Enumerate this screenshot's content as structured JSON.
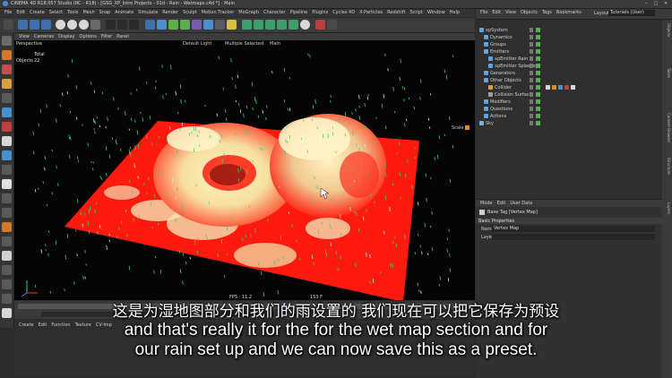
{
  "window": {
    "title": "CINEMA 4D R18.057 Studio (RC - R18) - [GSG_XP_Intro Projects - 01d - Rain - Wetmaps.c4d *] - Main"
  },
  "menubar": {
    "items": [
      "File",
      "Edit",
      "Create",
      "Select",
      "Tools",
      "Mesh",
      "Snap",
      "Animate",
      "Simulate",
      "Render",
      "Sculpt",
      "Motion Tracker",
      "MoGraph",
      "Character",
      "Pipeline",
      "Plugins",
      "Cycles 4D",
      "X-Particles",
      "Redshift",
      "Script",
      "Window",
      "Help"
    ]
  },
  "layout": {
    "label": "Layout:",
    "value": "Tutorials (User)"
  },
  "viewport": {
    "menu": [
      "View",
      "Cameras",
      "Display",
      "Options",
      "Filter",
      "Panel"
    ],
    "name": "Perspective",
    "overlay_items": [
      "Default Light",
      "Multiple Selected",
      "Main"
    ],
    "stats_label": "Total",
    "objects_label": "Objects",
    "objects_value": "22",
    "scale_label": "Scale",
    "fps": "FPS : 11.2",
    "frame": "153 F"
  },
  "object_manager": {
    "menu": [
      "File",
      "Edit",
      "View",
      "Objects",
      "Tags",
      "Bookmarks"
    ],
    "items": [
      {
        "label": "xpSystem",
        "indent": 0,
        "color": "#5fa3e0"
      },
      {
        "label": "Dynamics",
        "indent": 1,
        "color": "#5fa3e0"
      },
      {
        "label": "Groups",
        "indent": 1,
        "color": "#5fa3e0"
      },
      {
        "label": "Emitters",
        "indent": 1,
        "color": "#5fa3e0"
      },
      {
        "label": "xpEmitter Rain",
        "indent": 2,
        "color": "#5fa3e0"
      },
      {
        "label": "xpEmitter Splashes",
        "indent": 2,
        "color": "#5fa3e0"
      },
      {
        "label": "Generators",
        "indent": 1,
        "color": "#5fa3e0"
      },
      {
        "label": "Other Objects",
        "indent": 1,
        "color": "#5fa3e0"
      },
      {
        "label": "Collider",
        "indent": 2,
        "color": "#e0a040"
      },
      {
        "label": "Collision Surface",
        "indent": 2,
        "color": "#a0a0a0"
      },
      {
        "label": "Modifiers",
        "indent": 1,
        "color": "#5fa3e0"
      },
      {
        "label": "Questions",
        "indent": 1,
        "color": "#5fa3e0"
      },
      {
        "label": "Actions",
        "indent": 1,
        "color": "#5fa3e0"
      },
      {
        "label": "Sky",
        "indent": 0,
        "color": "#7ab0e0"
      }
    ]
  },
  "attribute_manager": {
    "menu": [
      "Mode",
      "Edit",
      "User Data"
    ],
    "title": "Base Tag [Vertex Map]",
    "section": "Basic Properties",
    "name_label": "Name",
    "name_value": "Vertex Map",
    "layer_label": "Layer"
  },
  "bottom_menu": [
    "Create",
    "Edit",
    "Function",
    "Texture",
    "CV-Imp"
  ],
  "vtabs": [
    "Objects",
    "Takes",
    "Content Browser",
    "Structure",
    "Layers"
  ],
  "subtitles": {
    "zh": "这是为湿地图部分和我们的雨设置的 我们现在可以把它保存为预设",
    "en1": "and that's really it for the for the wet map section and for",
    "en2": "our rain set up and we can now save this as a preset."
  },
  "colors": {
    "accent": "#4a90d9",
    "heat_red": "#ff1a10",
    "heat_cream": "#f4e4a8",
    "rain_green": "#3bd16f"
  }
}
